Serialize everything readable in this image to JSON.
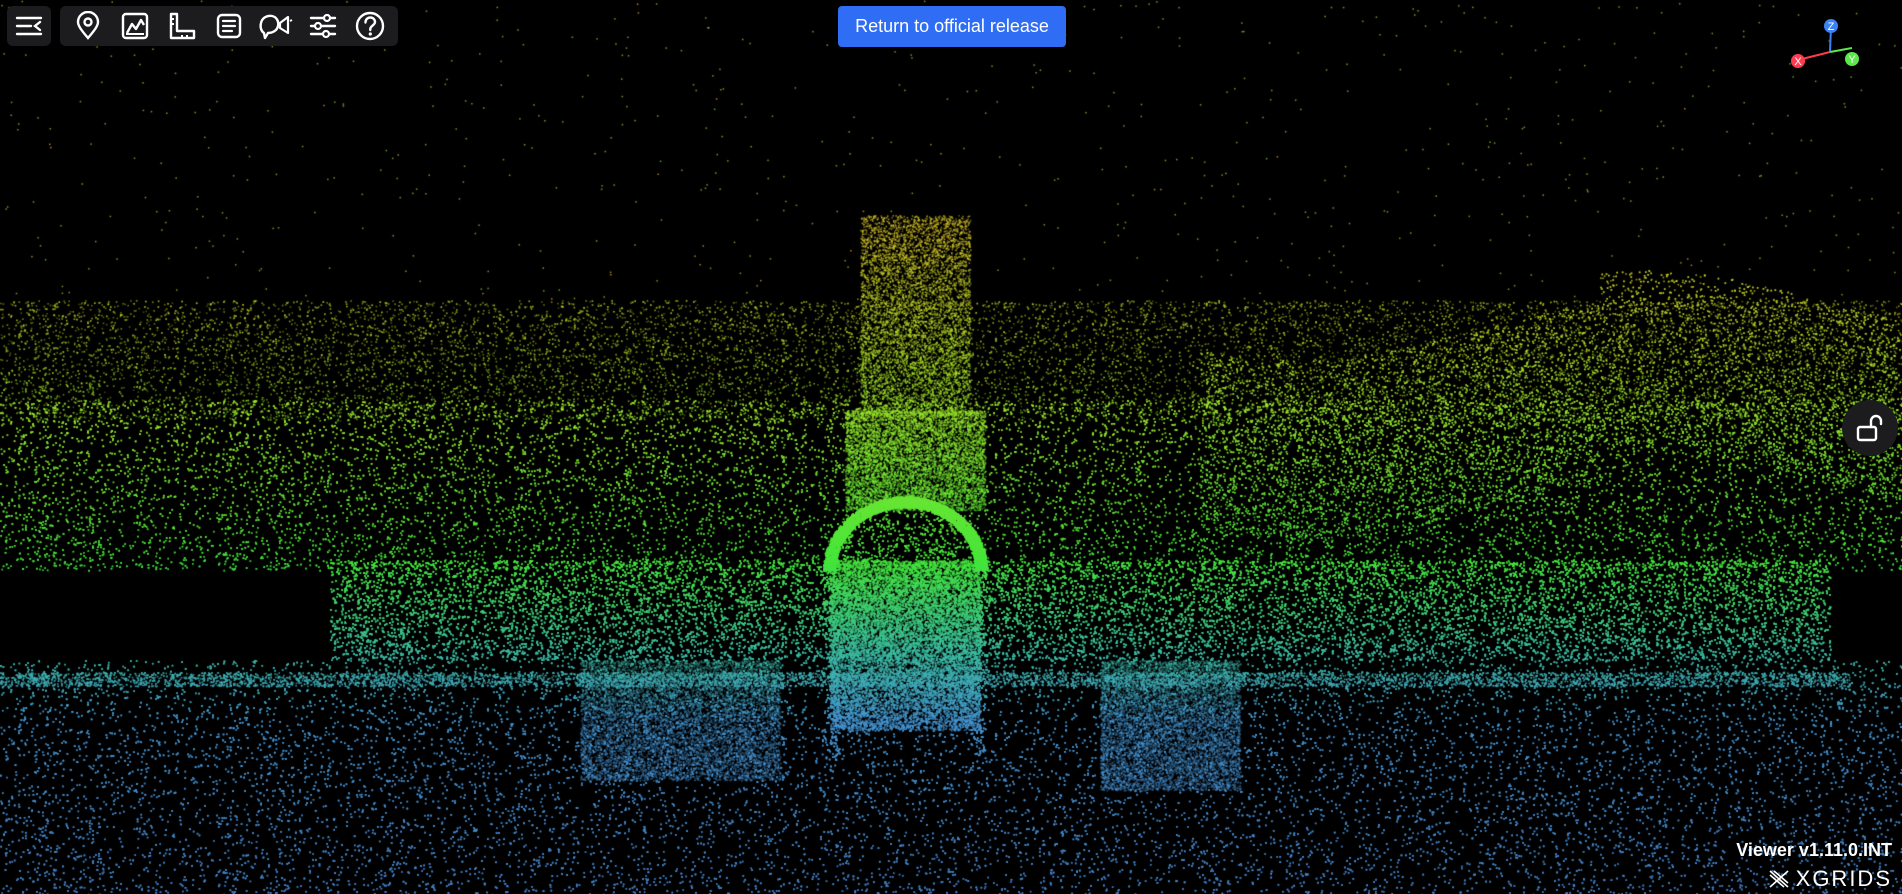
{
  "toolbar": {
    "menu_icon": "collapse-menu-icon",
    "tools": [
      {
        "id": "location",
        "icon": "map-pin-icon"
      },
      {
        "id": "elevation",
        "icon": "mountain-chart-icon"
      },
      {
        "id": "measure",
        "icon": "ruler-icon"
      },
      {
        "id": "notes",
        "icon": "document-list-icon"
      },
      {
        "id": "annotate",
        "icon": "speech-announce-icon"
      },
      {
        "id": "settings",
        "icon": "sliders-icon"
      },
      {
        "id": "help",
        "icon": "question-circle-icon"
      }
    ]
  },
  "header": {
    "return_label": "Return to official release"
  },
  "axes": {
    "z_label": "Z",
    "x_label": "X",
    "y_label": "Y",
    "colors": {
      "x": "#ff3b52",
      "y": "#5be84a",
      "z": "#3b82f6"
    }
  },
  "lock": {
    "icon": "unlock-icon"
  },
  "footer": {
    "version": "Viewer v1.11.0.INT",
    "brand": "XGRIDS"
  },
  "colors": {
    "accent": "#2f6df5",
    "panel": "#1c1c1e",
    "background": "#000000"
  }
}
